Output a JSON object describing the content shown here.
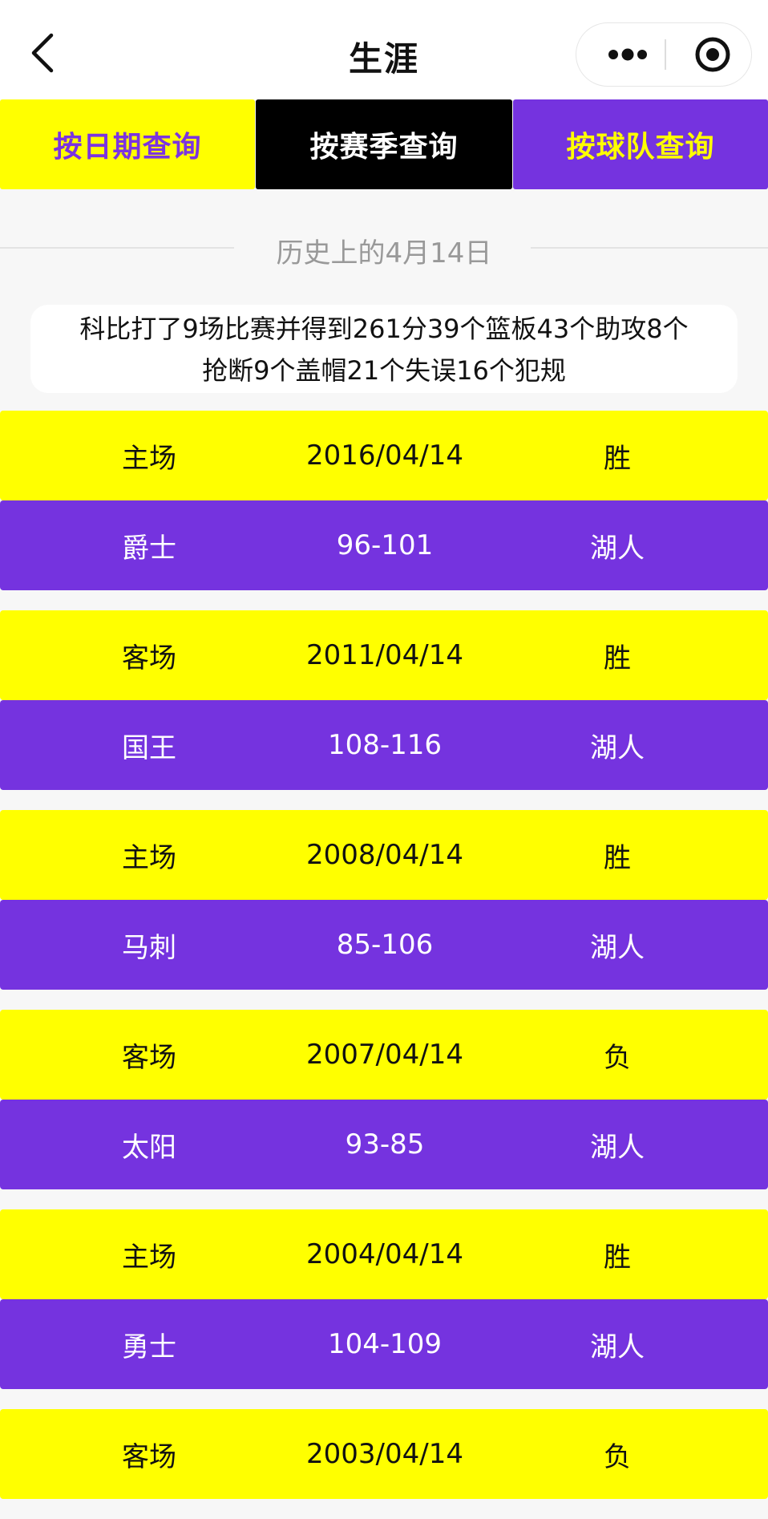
{
  "navbar": {
    "title": "生涯",
    "back_icon": "chevron-left-icon",
    "more_icon": "more-dots-icon",
    "close_icon": "target-circle-icon"
  },
  "tabs": [
    {
      "label": "按日期查询",
      "bg": "#ffff00",
      "color": "#7b33e0"
    },
    {
      "label": "按赛季查询",
      "bg": "#000000",
      "color": "#ffffff"
    },
    {
      "label": "按球队查询",
      "bg": "#7533df",
      "color": "#ffff00"
    }
  ],
  "history": {
    "label": "历史上的4月14日"
  },
  "summary": {
    "line1": "科比打了9场比赛并得到261分39个篮板43个助攻8个",
    "line2": "抢断9个盖帽21个失误16个犯规"
  },
  "colors": {
    "yellow": "#ffff00",
    "purple": "#7533df",
    "black": "#000000",
    "background": "#f7f7f7"
  },
  "games": [
    {
      "venue": "主场",
      "date": "2016/04/14",
      "result": "胜",
      "opponent": "爵士",
      "score": "96-101",
      "team": "湖人"
    },
    {
      "venue": "客场",
      "date": "2011/04/14",
      "result": "胜",
      "opponent": "国王",
      "score": "108-116",
      "team": "湖人"
    },
    {
      "venue": "主场",
      "date": "2008/04/14",
      "result": "胜",
      "opponent": "马刺",
      "score": "85-106",
      "team": "湖人"
    },
    {
      "venue": "客场",
      "date": "2007/04/14",
      "result": "负",
      "opponent": "太阳",
      "score": "93-85",
      "team": "湖人"
    },
    {
      "venue": "主场",
      "date": "2004/04/14",
      "result": "胜",
      "opponent": "勇士",
      "score": "104-109",
      "team": "湖人"
    },
    {
      "venue": "客场",
      "date": "2003/04/14",
      "result": "负",
      "opponent": "",
      "score": "",
      "team": ""
    }
  ]
}
